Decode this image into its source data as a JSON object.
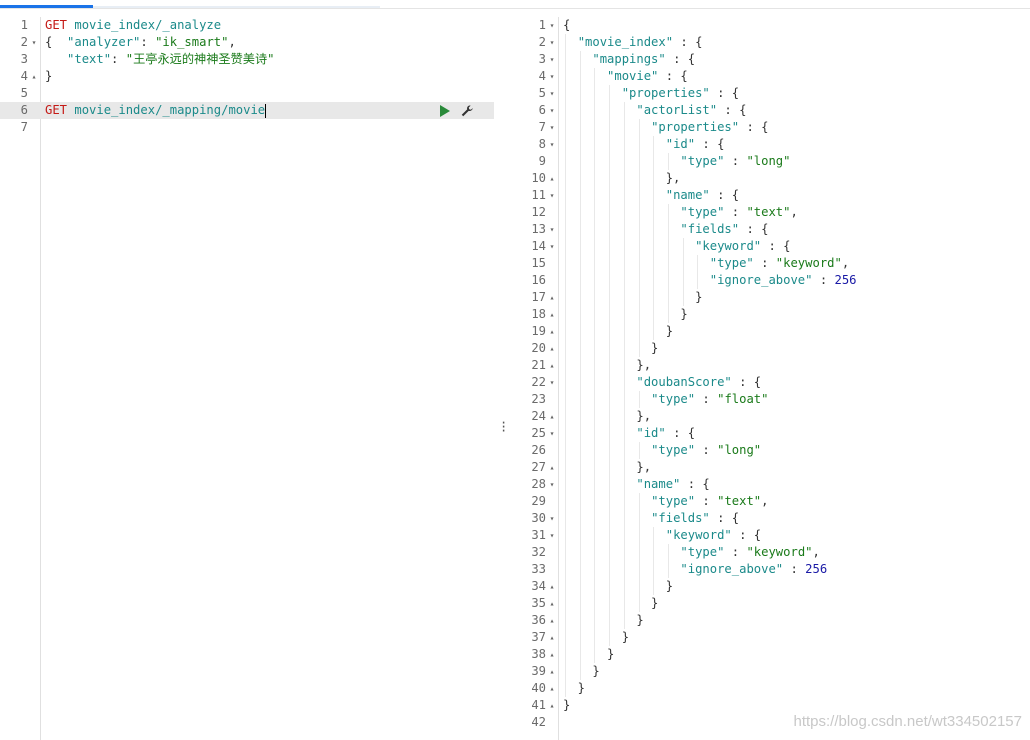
{
  "editor": {
    "lines": [
      {
        "ln": "1",
        "fold": "",
        "tokens": [
          [
            "m",
            "GET "
          ],
          [
            "u",
            "movie_index/_analyze"
          ]
        ]
      },
      {
        "ln": "2",
        "fold": "▾",
        "tokens": [
          [
            "p",
            "{  "
          ],
          [
            "k",
            "\"analyzer\""
          ],
          [
            "p",
            ": "
          ],
          [
            "s",
            "\"ik_smart\""
          ],
          [
            "p",
            ","
          ]
        ]
      },
      {
        "ln": "3",
        "fold": "",
        "tokens": [
          [
            "p",
            "   "
          ],
          [
            "k",
            "\"text\""
          ],
          [
            "p",
            ": "
          ],
          [
            "s",
            "\"王亭永远的神神圣赞美诗\""
          ]
        ]
      },
      {
        "ln": "4",
        "fold": "▴",
        "tokens": [
          [
            "p",
            "}"
          ]
        ]
      },
      {
        "ln": "5",
        "fold": "",
        "tokens": []
      },
      {
        "ln": "6",
        "fold": "",
        "tokens": [
          [
            "m",
            "GET "
          ],
          [
            "u",
            "movie_index/_mapping/movie"
          ]
        ],
        "active": true
      },
      {
        "ln": "7",
        "fold": "",
        "tokens": []
      }
    ],
    "actions": {
      "run": "play-icon",
      "settings": "wrench-icon"
    }
  },
  "response": {
    "lines": [
      {
        "ln": "1",
        "fold": "▾",
        "tokens": [
          [
            "p",
            "{"
          ]
        ]
      },
      {
        "ln": "2",
        "fold": "▾",
        "tokens": [
          [
            "p",
            "  "
          ],
          [
            "k",
            "\"movie_index\""
          ],
          [
            "p",
            " : {"
          ]
        ]
      },
      {
        "ln": "3",
        "fold": "▾",
        "tokens": [
          [
            "p",
            "    "
          ],
          [
            "k",
            "\"mappings\""
          ],
          [
            "p",
            " : {"
          ]
        ]
      },
      {
        "ln": "4",
        "fold": "▾",
        "tokens": [
          [
            "p",
            "      "
          ],
          [
            "k",
            "\"movie\""
          ],
          [
            "p",
            " : {"
          ]
        ]
      },
      {
        "ln": "5",
        "fold": "▾",
        "tokens": [
          [
            "p",
            "        "
          ],
          [
            "k",
            "\"properties\""
          ],
          [
            "p",
            " : {"
          ]
        ]
      },
      {
        "ln": "6",
        "fold": "▾",
        "tokens": [
          [
            "p",
            "          "
          ],
          [
            "k",
            "\"actorList\""
          ],
          [
            "p",
            " : {"
          ]
        ]
      },
      {
        "ln": "7",
        "fold": "▾",
        "tokens": [
          [
            "p",
            "            "
          ],
          [
            "k",
            "\"properties\""
          ],
          [
            "p",
            " : {"
          ]
        ]
      },
      {
        "ln": "8",
        "fold": "▾",
        "tokens": [
          [
            "p",
            "              "
          ],
          [
            "k",
            "\"id\""
          ],
          [
            "p",
            " : {"
          ]
        ]
      },
      {
        "ln": "9",
        "fold": "",
        "tokens": [
          [
            "p",
            "                "
          ],
          [
            "k",
            "\"type\""
          ],
          [
            "p",
            " : "
          ],
          [
            "s",
            "\"long\""
          ]
        ]
      },
      {
        "ln": "10",
        "fold": "▴",
        "tokens": [
          [
            "p",
            "              },"
          ]
        ]
      },
      {
        "ln": "11",
        "fold": "▾",
        "tokens": [
          [
            "p",
            "              "
          ],
          [
            "k",
            "\"name\""
          ],
          [
            "p",
            " : {"
          ]
        ]
      },
      {
        "ln": "12",
        "fold": "",
        "tokens": [
          [
            "p",
            "                "
          ],
          [
            "k",
            "\"type\""
          ],
          [
            "p",
            " : "
          ],
          [
            "s",
            "\"text\""
          ],
          [
            "p",
            ","
          ]
        ]
      },
      {
        "ln": "13",
        "fold": "▾",
        "tokens": [
          [
            "p",
            "                "
          ],
          [
            "k",
            "\"fields\""
          ],
          [
            "p",
            " : {"
          ]
        ]
      },
      {
        "ln": "14",
        "fold": "▾",
        "tokens": [
          [
            "p",
            "                  "
          ],
          [
            "k",
            "\"keyword\""
          ],
          [
            "p",
            " : {"
          ]
        ]
      },
      {
        "ln": "15",
        "fold": "",
        "tokens": [
          [
            "p",
            "                    "
          ],
          [
            "k",
            "\"type\""
          ],
          [
            "p",
            " : "
          ],
          [
            "s",
            "\"keyword\""
          ],
          [
            "p",
            ","
          ]
        ]
      },
      {
        "ln": "16",
        "fold": "",
        "tokens": [
          [
            "p",
            "                    "
          ],
          [
            "k",
            "\"ignore_above\""
          ],
          [
            "p",
            " : "
          ],
          [
            "n",
            "256"
          ]
        ]
      },
      {
        "ln": "17",
        "fold": "▴",
        "tokens": [
          [
            "p",
            "                  }"
          ]
        ]
      },
      {
        "ln": "18",
        "fold": "▴",
        "tokens": [
          [
            "p",
            "                }"
          ]
        ]
      },
      {
        "ln": "19",
        "fold": "▴",
        "tokens": [
          [
            "p",
            "              }"
          ]
        ]
      },
      {
        "ln": "20",
        "fold": "▴",
        "tokens": [
          [
            "p",
            "            }"
          ]
        ]
      },
      {
        "ln": "21",
        "fold": "▴",
        "tokens": [
          [
            "p",
            "          },"
          ]
        ]
      },
      {
        "ln": "22",
        "fold": "▾",
        "tokens": [
          [
            "p",
            "          "
          ],
          [
            "k",
            "\"doubanScore\""
          ],
          [
            "p",
            " : {"
          ]
        ]
      },
      {
        "ln": "23",
        "fold": "",
        "tokens": [
          [
            "p",
            "            "
          ],
          [
            "k",
            "\"type\""
          ],
          [
            "p",
            " : "
          ],
          [
            "s",
            "\"float\""
          ]
        ]
      },
      {
        "ln": "24",
        "fold": "▴",
        "tokens": [
          [
            "p",
            "          },"
          ]
        ]
      },
      {
        "ln": "25",
        "fold": "▾",
        "tokens": [
          [
            "p",
            "          "
          ],
          [
            "k",
            "\"id\""
          ],
          [
            "p",
            " : {"
          ]
        ]
      },
      {
        "ln": "26",
        "fold": "",
        "tokens": [
          [
            "p",
            "            "
          ],
          [
            "k",
            "\"type\""
          ],
          [
            "p",
            " : "
          ],
          [
            "s",
            "\"long\""
          ]
        ]
      },
      {
        "ln": "27",
        "fold": "▴",
        "tokens": [
          [
            "p",
            "          },"
          ]
        ]
      },
      {
        "ln": "28",
        "fold": "▾",
        "tokens": [
          [
            "p",
            "          "
          ],
          [
            "k",
            "\"name\""
          ],
          [
            "p",
            " : {"
          ]
        ]
      },
      {
        "ln": "29",
        "fold": "",
        "tokens": [
          [
            "p",
            "            "
          ],
          [
            "k",
            "\"type\""
          ],
          [
            "p",
            " : "
          ],
          [
            "s",
            "\"text\""
          ],
          [
            "p",
            ","
          ]
        ]
      },
      {
        "ln": "30",
        "fold": "▾",
        "tokens": [
          [
            "p",
            "            "
          ],
          [
            "k",
            "\"fields\""
          ],
          [
            "p",
            " : {"
          ]
        ]
      },
      {
        "ln": "31",
        "fold": "▾",
        "tokens": [
          [
            "p",
            "              "
          ],
          [
            "k",
            "\"keyword\""
          ],
          [
            "p",
            " : {"
          ]
        ]
      },
      {
        "ln": "32",
        "fold": "",
        "tokens": [
          [
            "p",
            "                "
          ],
          [
            "k",
            "\"type\""
          ],
          [
            "p",
            " : "
          ],
          [
            "s",
            "\"keyword\""
          ],
          [
            "p",
            ","
          ]
        ]
      },
      {
        "ln": "33",
        "fold": "",
        "tokens": [
          [
            "p",
            "                "
          ],
          [
            "k",
            "\"ignore_above\""
          ],
          [
            "p",
            " : "
          ],
          [
            "n",
            "256"
          ]
        ]
      },
      {
        "ln": "34",
        "fold": "▴",
        "tokens": [
          [
            "p",
            "              }"
          ]
        ]
      },
      {
        "ln": "35",
        "fold": "▴",
        "tokens": [
          [
            "p",
            "            }"
          ]
        ]
      },
      {
        "ln": "36",
        "fold": "▴",
        "tokens": [
          [
            "p",
            "          }"
          ]
        ]
      },
      {
        "ln": "37",
        "fold": "▴",
        "tokens": [
          [
            "p",
            "        }"
          ]
        ]
      },
      {
        "ln": "38",
        "fold": "▴",
        "tokens": [
          [
            "p",
            "      }"
          ]
        ]
      },
      {
        "ln": "39",
        "fold": "▴",
        "tokens": [
          [
            "p",
            "    }"
          ]
        ]
      },
      {
        "ln": "40",
        "fold": "▴",
        "tokens": [
          [
            "p",
            "  }"
          ]
        ]
      },
      {
        "ln": "41",
        "fold": "▴",
        "tokens": [
          [
            "p",
            "}"
          ]
        ]
      },
      {
        "ln": "42",
        "fold": "",
        "tokens": []
      }
    ]
  },
  "watermark": "https://blog.csdn.net/wt334502157",
  "colors": {
    "method": "#c41a16",
    "key": "#1b8a8a",
    "string": "#1a7a1a",
    "number": "#1a1aa6",
    "run_button": "#2a8a3a",
    "active_tab": "#1a73e8"
  }
}
